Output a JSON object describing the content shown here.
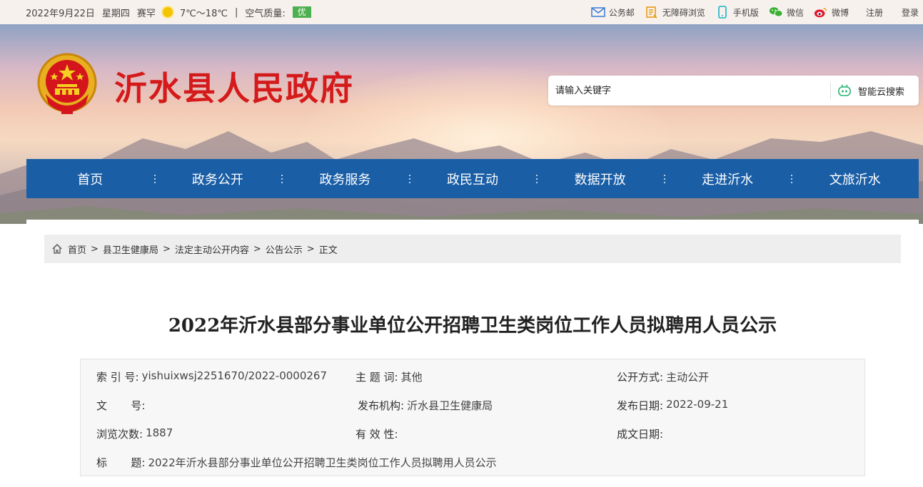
{
  "topbar": {
    "date": "2022年9月22日",
    "weekday": "星期四",
    "city": "赛罕",
    "weather_icon": "sun-icon",
    "temperature": "7℃～18℃",
    "separator": "|",
    "air_quality_label": "空气质量:",
    "air_quality_value": "优",
    "links": [
      {
        "label": "公务邮",
        "icon": "mail-icon"
      },
      {
        "label": "无障碍浏览",
        "icon": "accessibility-icon"
      },
      {
        "label": "手机版",
        "icon": "mobile-icon"
      },
      {
        "label": "微信",
        "icon": "wechat-icon"
      },
      {
        "label": "微博",
        "icon": "weibo-icon"
      },
      {
        "label": "注册"
      },
      {
        "label": "登录"
      }
    ]
  },
  "header": {
    "site_title": "沂水县人民政府",
    "search_placeholder": "请输入关键字",
    "search_button": "智能云搜索"
  },
  "nav": {
    "items": [
      "首页",
      "政务公开",
      "政务服务",
      "政民互动",
      "数据开放",
      "走进沂水",
      "文旅沂水"
    ]
  },
  "breadcrumb": {
    "items": [
      "首页",
      "县卫生健康局",
      "法定主动公开内容",
      "公告公示",
      "正文"
    ],
    "separator": ">"
  },
  "article": {
    "title": "2022年沂水县部分事业单位公开招聘卫生类岗位工作人员拟聘用人员公示",
    "meta": {
      "index_label": "索 引 号:",
      "index_value": "yishuixwsj2251670/2022-0000267",
      "keyword_label": "主 题 词:",
      "keyword_value": "其他",
      "open_mode_label": "公开方式:",
      "open_mode_value": "主动公开",
      "doc_no_label": "文       号:",
      "doc_no_value": "",
      "publisher_label": "发布机构:",
      "publisher_value": "沂水县卫生健康局",
      "pub_date_label": "发布日期:",
      "pub_date_value": "2022-09-21",
      "views_label": "浏览次数:",
      "views_value": "1887",
      "validity_label": "有 效 性:",
      "validity_value": "",
      "made_date_label": "成文日期:",
      "made_date_value": "",
      "title_label": "标       题:",
      "title_value": "2022年沂水县部分事业单位公开招聘卫生类岗位工作人员拟聘用人员公示"
    }
  },
  "colors": {
    "nav_bg": "#1a5ea6",
    "title_red": "#d41a1a",
    "aqi_green": "#4caf50"
  }
}
